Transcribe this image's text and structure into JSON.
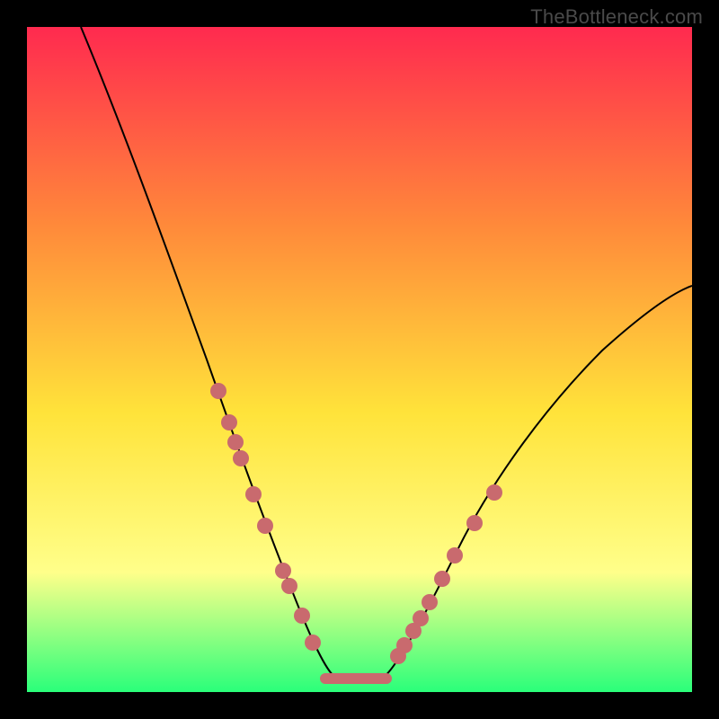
{
  "watermark": "TheBottleneck.com",
  "colors": {
    "gradient_top": "#ff2a4f",
    "gradient_mid1": "#ff8a3a",
    "gradient_mid2": "#ffe33a",
    "gradient_mid3": "#ffff8a",
    "gradient_bottom": "#2aff7a",
    "curve": "#000000",
    "dot": "#c96a6e",
    "background": "#000000"
  },
  "chart_data": {
    "type": "line",
    "title": "",
    "xlabel": "",
    "ylabel": "",
    "xlim": [
      0,
      100
    ],
    "ylim": [
      0,
      100
    ],
    "series": [
      {
        "name": "left_curve",
        "x": [
          10,
          15,
          20,
          25,
          27,
          29,
          31,
          33,
          35,
          37,
          39,
          41,
          43,
          45
        ],
        "y": [
          100,
          84,
          67,
          50,
          43,
          37,
          31,
          25,
          20,
          15,
          11,
          7,
          4,
          2
        ]
      },
      {
        "name": "flat_bottom",
        "x": [
          45,
          50,
          53
        ],
        "y": [
          2,
          2,
          2
        ]
      },
      {
        "name": "right_curve",
        "x": [
          53,
          56,
          60,
          65,
          70,
          75,
          80,
          85,
          90,
          95,
          100
        ],
        "y": [
          2,
          5,
          10,
          17,
          24,
          31,
          37,
          43,
          49,
          54,
          58
        ]
      }
    ],
    "highlight_dots": {
      "left": [
        {
          "x": 27,
          "y": 43
        },
        {
          "x": 29,
          "y": 37
        },
        {
          "x": 30,
          "y": 34
        },
        {
          "x": 31,
          "y": 31
        },
        {
          "x": 33,
          "y": 25
        },
        {
          "x": 35,
          "y": 20
        },
        {
          "x": 38,
          "y": 13
        },
        {
          "x": 39,
          "y": 11
        },
        {
          "x": 41,
          "y": 7
        },
        {
          "x": 43,
          "y": 4
        }
      ],
      "right": [
        {
          "x": 55,
          "y": 4
        },
        {
          "x": 56,
          "y": 5
        },
        {
          "x": 57.5,
          "y": 7
        },
        {
          "x": 58.5,
          "y": 8.5
        },
        {
          "x": 60,
          "y": 10
        },
        {
          "x": 62,
          "y": 13
        },
        {
          "x": 64,
          "y": 16
        },
        {
          "x": 67,
          "y": 20
        },
        {
          "x": 70,
          "y": 24
        }
      ]
    }
  }
}
